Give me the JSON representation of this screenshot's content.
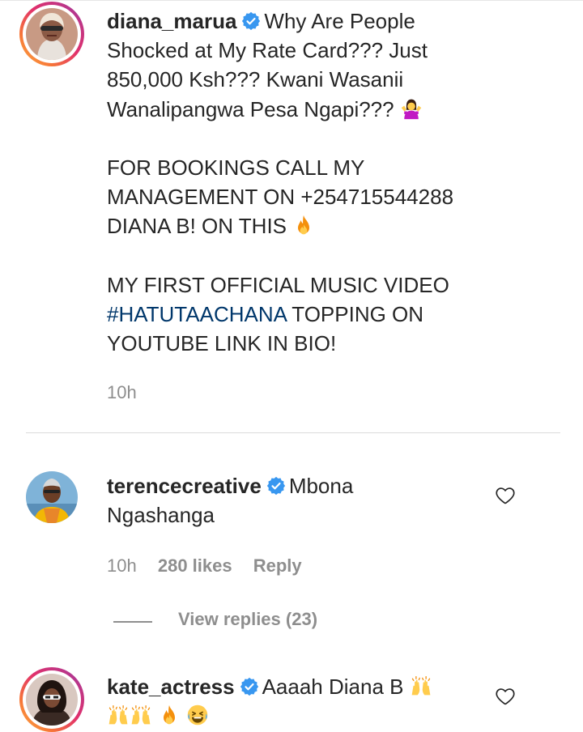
{
  "post": {
    "username": "diana_marua",
    "caption_lines": [
      "Why Are People",
      "Shocked at My Rate Card??? Just",
      "850,000 Ksh??? Kwani Wasanii",
      "Wanalipangwa Pesa Ngapi???"
    ],
    "booking_lines": [
      "FOR BOOKINGS CALL MY",
      "MANAGEMENT ON +254715544288",
      "DIANA B! ON THIS"
    ],
    "music_line1": "MY FIRST OFFICIAL MUSIC VIDEO",
    "hashtag": "#HATUTAACHANA",
    "music_line2_rest": " TOPPING ON",
    "music_line3": "YOUTUBE LINK IN BIO!",
    "time": "10h",
    "emojis": [
      "person-shrugging-emoji",
      "fire-emoji"
    ]
  },
  "comments": [
    {
      "username": "terencecreative",
      "text_line1": "Mbona",
      "text_line2": "Ngashanga",
      "time": "10h",
      "likes": "280 likes",
      "reply_label": "Reply",
      "view_replies": "View replies (23)"
    },
    {
      "username": "kate_actress",
      "text_line1": "Aaaah Diana B",
      "emojis": [
        "raising-hands-emoji",
        "raising-hands-emoji",
        "raising-hands-emoji",
        "fire-emoji",
        "tears-of-joy-emoji"
      ]
    }
  ],
  "colors": {
    "text": "#262626",
    "secondary": "#8e8e8e",
    "hashtag": "#00376b",
    "verified": "#3897f0",
    "divider": "#dbdbdb"
  }
}
